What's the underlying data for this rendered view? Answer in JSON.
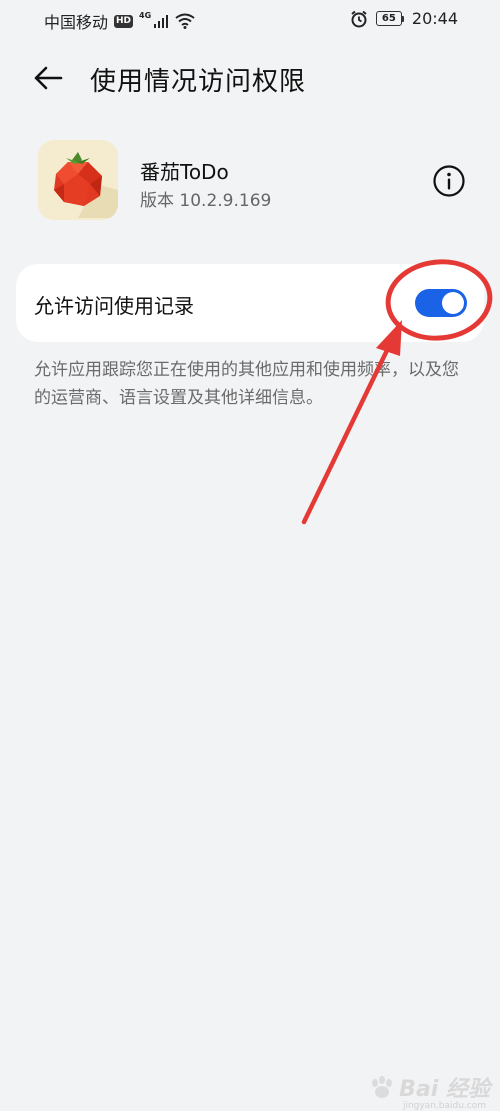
{
  "status_bar": {
    "carrier": "中国移动",
    "hd": "HD",
    "network": "4G",
    "battery": "65",
    "time": "20:44"
  },
  "header": {
    "title": "使用情况访问权限"
  },
  "app": {
    "name": "番茄ToDo",
    "version": "版本 10.2.9.169"
  },
  "permission": {
    "label": "允许访问使用记录",
    "enabled": true,
    "description": "允许应用跟踪您正在使用的其他应用和使用频率，以及您的运营商、语言设置及其他详细信息。"
  },
  "watermark": {
    "text": "Bai 经验",
    "url": "jingyan.baidu.com"
  },
  "colors": {
    "accent": "#1a62e6",
    "annotation": "#e53935",
    "background": "#f2f3f5"
  }
}
